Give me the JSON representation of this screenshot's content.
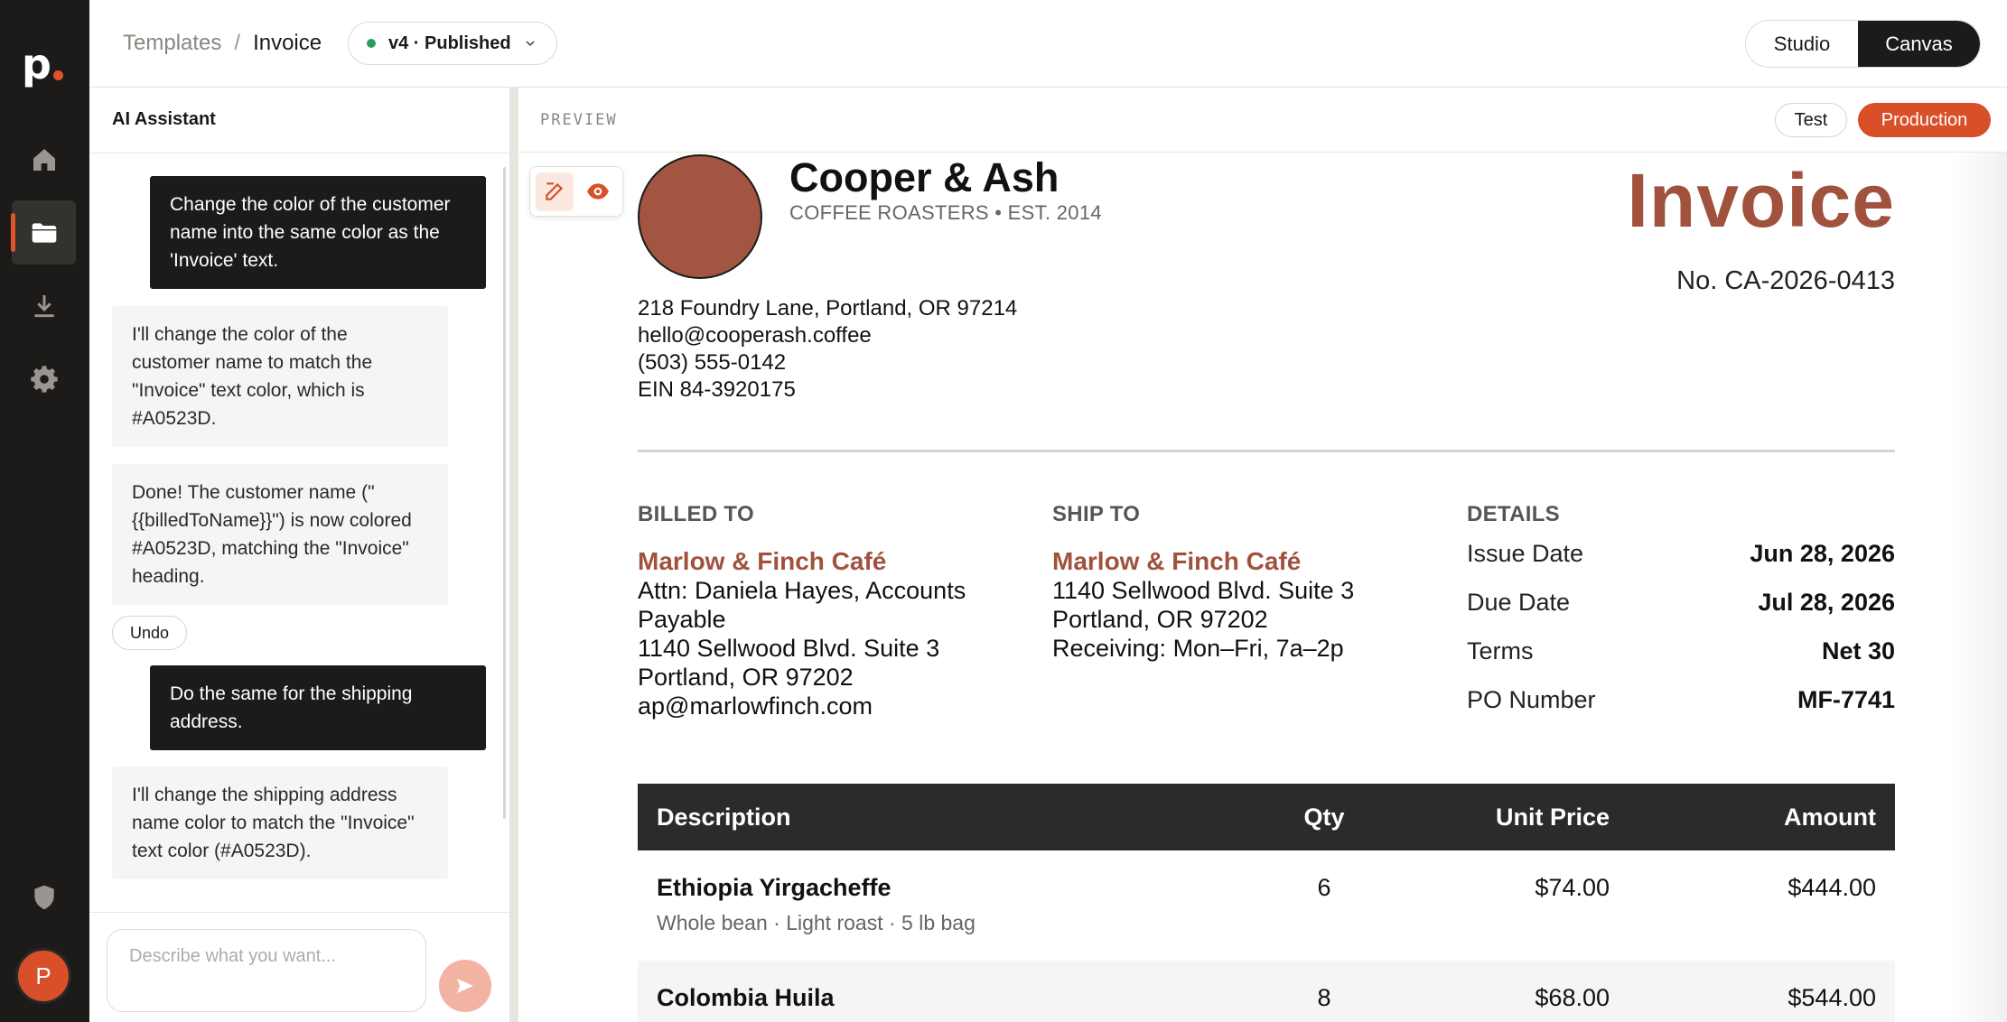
{
  "app": {
    "logo": "p",
    "avatar_initial": "P"
  },
  "breadcrumb": {
    "parent": "Templates",
    "separator": "/",
    "current": "Invoice"
  },
  "version": {
    "label": "v4 · Published",
    "status_color": "#2aa05a"
  },
  "mode_toggle": {
    "studio": "Studio",
    "canvas": "Canvas",
    "selected": "Canvas"
  },
  "assistant": {
    "title": "AI Assistant",
    "messages": [
      {
        "role": "user",
        "text": "Change the color of the customer name into the same color as the 'Invoice' text."
      },
      {
        "role": "assistant",
        "text": "I'll change the color of the customer name to match the \"Invoice\" text color, which is #A0523D."
      },
      {
        "role": "assistant",
        "text": "Done! The customer name (\"{{billedToName}}\") is now colored #A0523D, matching the \"Invoice\" heading."
      },
      {
        "role": "user",
        "text": "Do the same for the shipping address."
      },
      {
        "role": "assistant",
        "text": "I'll change the shipping address name color to match the \"Invoice\" text color (#A0523D)."
      }
    ],
    "undo_label": "Undo",
    "input_placeholder": "Describe what you want..."
  },
  "preview": {
    "label": "PREVIEW",
    "env_test": "Test",
    "env_production": "Production",
    "selected_env": "Production"
  },
  "invoice": {
    "accent_color": "#A0523D",
    "company": "Cooper & Ash",
    "tagline": "COFFEE ROASTERS • EST. 2014",
    "title": "Invoice",
    "number": "No. CA-2026-0413",
    "address_lines": [
      "218 Foundry Lane, Portland, OR 97214",
      "hello@cooperash.coffee",
      "(503) 555-0142",
      "EIN 84-3920175"
    ],
    "billed_to": {
      "heading": "BILLED TO",
      "name": "Marlow & Finch Café",
      "lines": [
        "Attn: Daniela Hayes, Accounts Payable",
        "1140 Sellwood Blvd. Suite 3",
        "Portland, OR 97202",
        "ap@marlowfinch.com"
      ]
    },
    "ship_to": {
      "heading": "SHIP TO",
      "name": "Marlow & Finch Café",
      "lines": [
        "1140 Sellwood Blvd. Suite 3",
        "Portland, OR 97202",
        "Receiving: Mon–Fri, 7a–2p"
      ]
    },
    "details": {
      "heading": "DETAILS",
      "rows": [
        {
          "key": "Issue Date",
          "value": "Jun 28, 2026"
        },
        {
          "key": "Due Date",
          "value": "Jul 28, 2026"
        },
        {
          "key": "Terms",
          "value": "Net 30"
        },
        {
          "key": "PO Number",
          "value": "MF-7741"
        }
      ]
    },
    "table": {
      "headers": [
        "Description",
        "Qty",
        "Unit Price",
        "Amount"
      ],
      "rows": [
        {
          "name": "Ethiopia Yirgacheffe",
          "sub": "Whole bean · Light roast · 5 lb bag",
          "qty": "6",
          "unit": "$74.00",
          "amount": "$444.00"
        },
        {
          "name": "Colombia Huila",
          "sub": "",
          "qty": "8",
          "unit": "$68.00",
          "amount": "$544.00"
        }
      ]
    }
  }
}
